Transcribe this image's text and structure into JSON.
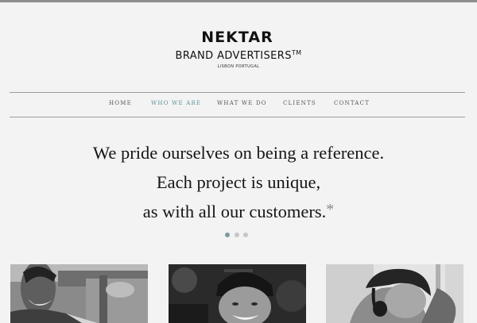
{
  "header": {
    "brand": "NEKTAR",
    "tagline": "BRAND ADVERTISERS",
    "trademark": "TM",
    "location": "LISBON PORTUGAL"
  },
  "nav": {
    "items": [
      {
        "label": "HOME",
        "active": false
      },
      {
        "label": "WHO WE ARE",
        "active": true
      },
      {
        "label": "WHAT WE DO",
        "active": false
      },
      {
        "label": "CLIENTS",
        "active": false
      },
      {
        "label": "CONTACT",
        "active": false
      }
    ]
  },
  "hero": {
    "line1": "We pride ourselves on being a reference.",
    "line2": "Each project is unique,",
    "line3": "as with all our customers.",
    "asterisk": "*"
  },
  "slider": {
    "count": 3,
    "active_index": 0
  },
  "colors": {
    "background": "#f3f3f3",
    "accent": "#5e9397",
    "dot_active": "#7d9aa1",
    "dot_inactive": "#c7c7c7"
  },
  "photos": [
    {
      "name": "team-photo-smiling-man"
    },
    {
      "name": "team-photo-man-in-beanie"
    },
    {
      "name": "team-photo-man-with-headphones"
    }
  ]
}
